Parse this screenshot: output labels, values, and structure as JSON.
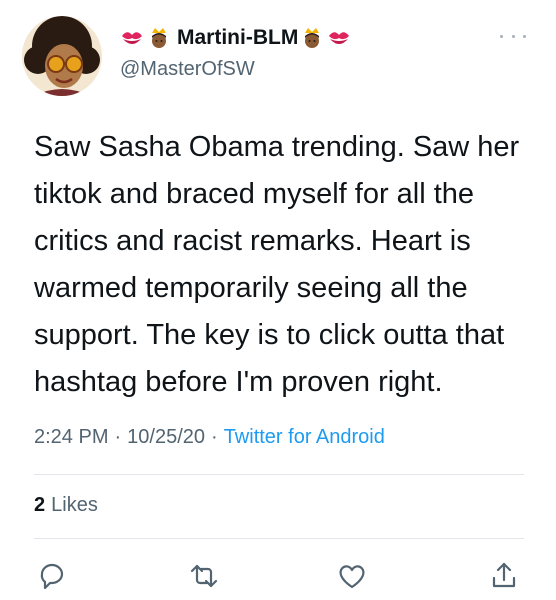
{
  "tweet": {
    "author": {
      "display_name": "Martini-BLM",
      "handle": "@MasterOfSW",
      "name_emojis": [
        "kiss-mark-icon",
        "crowned-queen-icon",
        "crowned-queen-icon",
        "kiss-mark-icon"
      ]
    },
    "text": "Saw Sasha Obama trending. Saw her tiktok and braced myself for all the critics and racist remarks. Heart is warmed temporarily seeing all the support. The key is to click outta that hashtag before I'm proven right.",
    "time": "2:24 PM",
    "separator": "·",
    "date": "10/25/20",
    "client": "Twitter for Android",
    "likes_count": "2",
    "likes_label": "Likes"
  },
  "icons": {
    "more": "more-dots-icon",
    "reply": "reply-icon",
    "retweet": "retweet-icon",
    "like": "heart-icon",
    "share": "share-icon"
  },
  "colors": {
    "text": "#0f1419",
    "secondary": "#536471",
    "link": "#1d9bf0",
    "icon": "#536471",
    "divider": "#e2e6ea"
  }
}
